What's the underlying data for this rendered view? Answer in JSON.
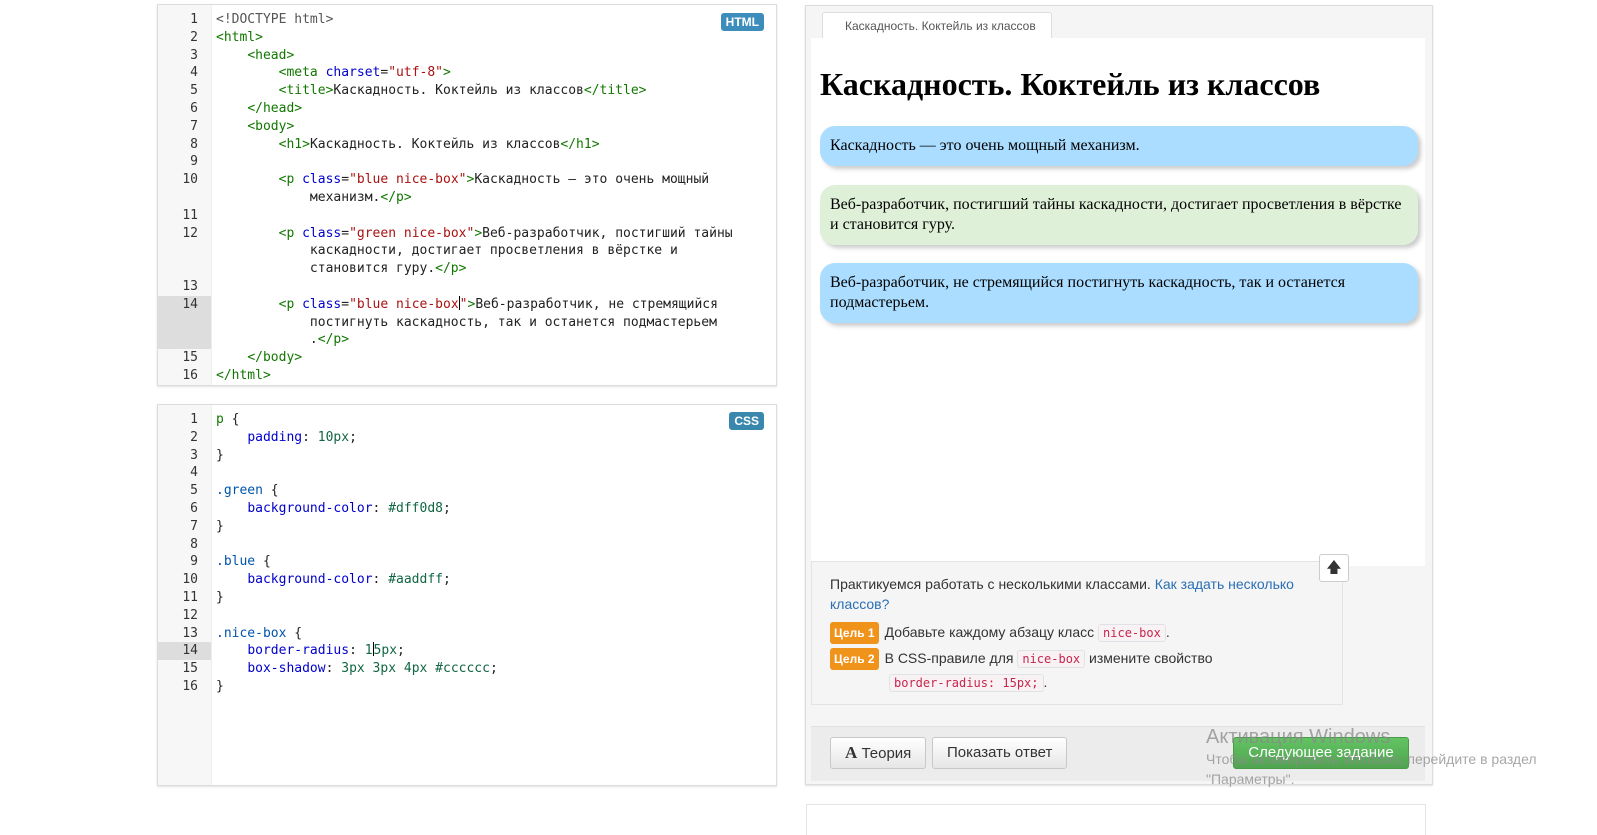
{
  "html_editor": {
    "badge": "HTML",
    "line_numbers": [
      "1",
      "2",
      "3",
      "4",
      "5",
      "6",
      "7",
      "8",
      "9",
      "10",
      "",
      "11",
      "12",
      "",
      "",
      "13",
      "14",
      "",
      "",
      "15",
      "16"
    ]
  },
  "css_editor": {
    "badge": "CSS",
    "line_numbers": [
      "1",
      "2",
      "3",
      "4",
      "5",
      "6",
      "7",
      "8",
      "9",
      "10",
      "11",
      "12",
      "13",
      "14",
      "15",
      "16"
    ]
  },
  "preview": {
    "tab_title": "Каскадность. Коктейль из классов",
    "heading": "Каскадность. Коктейль из классов",
    "paragraphs": [
      "Каскадность — это очень мощный механизм.",
      "Веб-разработчик, постигший тайны каскадности, достигает просветления в вёрстке и становится гуру.",
      "Веб-разработчик, не стремящийся постигнуть каскадность, так и останется подмастерьем."
    ]
  },
  "task": {
    "intro": "Практикуемся работать с несколькими классами.",
    "link": "Как задать несколько классов?",
    "goal1_label": "Цель 1",
    "goal1_text": "Добавьте каждому абзацу класс",
    "goal1_code": "nice-box",
    "goal2_label": "Цель 2",
    "goal2_text_a": "В CSS-правиле для",
    "goal2_code_a": "nice-box",
    "goal2_text_b": "измените свойство",
    "goal2_code_b": "border-radius: 15px;",
    "up_icon": "arrow-up-icon"
  },
  "toolbar": {
    "theory_label": "Теория",
    "answer_label": "Показать ответ",
    "next_label": "Следующее задание"
  },
  "watermark": {
    "line1": "Активация Windows",
    "line2": "Чтобы активировать Windows, перейдите в раздел",
    "line3": "\"Параметры\"."
  },
  "colors": {
    "blue": "#aaddff",
    "green": "#dff0d8",
    "badge": "#3c8dbc",
    "goal": "#f0931a",
    "next_button": "#5bb75b"
  }
}
